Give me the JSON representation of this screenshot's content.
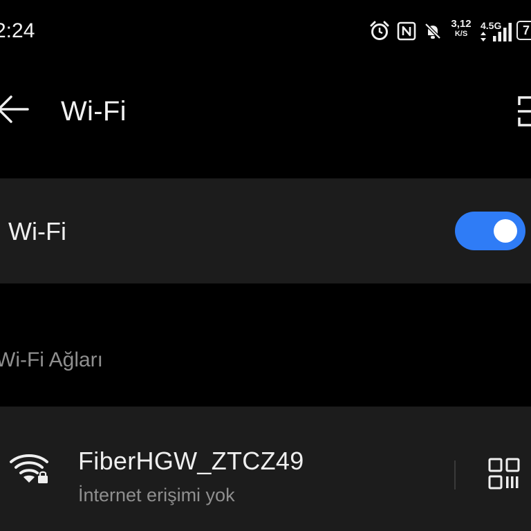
{
  "status_bar": {
    "time": "2:24",
    "speed_value": "3,12",
    "speed_unit": "K/S",
    "network_type": "4.5G",
    "battery_level": "7",
    "icons": [
      "alarm-icon",
      "nfc-icon",
      "bell-muted-icon",
      "signal-bars-icon",
      "battery-icon"
    ]
  },
  "app_bar": {
    "title": "Wi-Fi",
    "back_icon": "arrow-left-icon",
    "scan_icon": "scan-icon"
  },
  "wifi_toggle": {
    "label": "Wi-Fi",
    "enabled": true,
    "accent_color": "#2f7cf6"
  },
  "networks_section": {
    "header": "Wi-Fi Ağları",
    "networks": [
      {
        "ssid": "FiberHGW_ZTCZ49",
        "status": "İnternet erişimi yok",
        "icon": "wifi-locked-icon",
        "action_icon": "qr-code-icon"
      }
    ]
  }
}
